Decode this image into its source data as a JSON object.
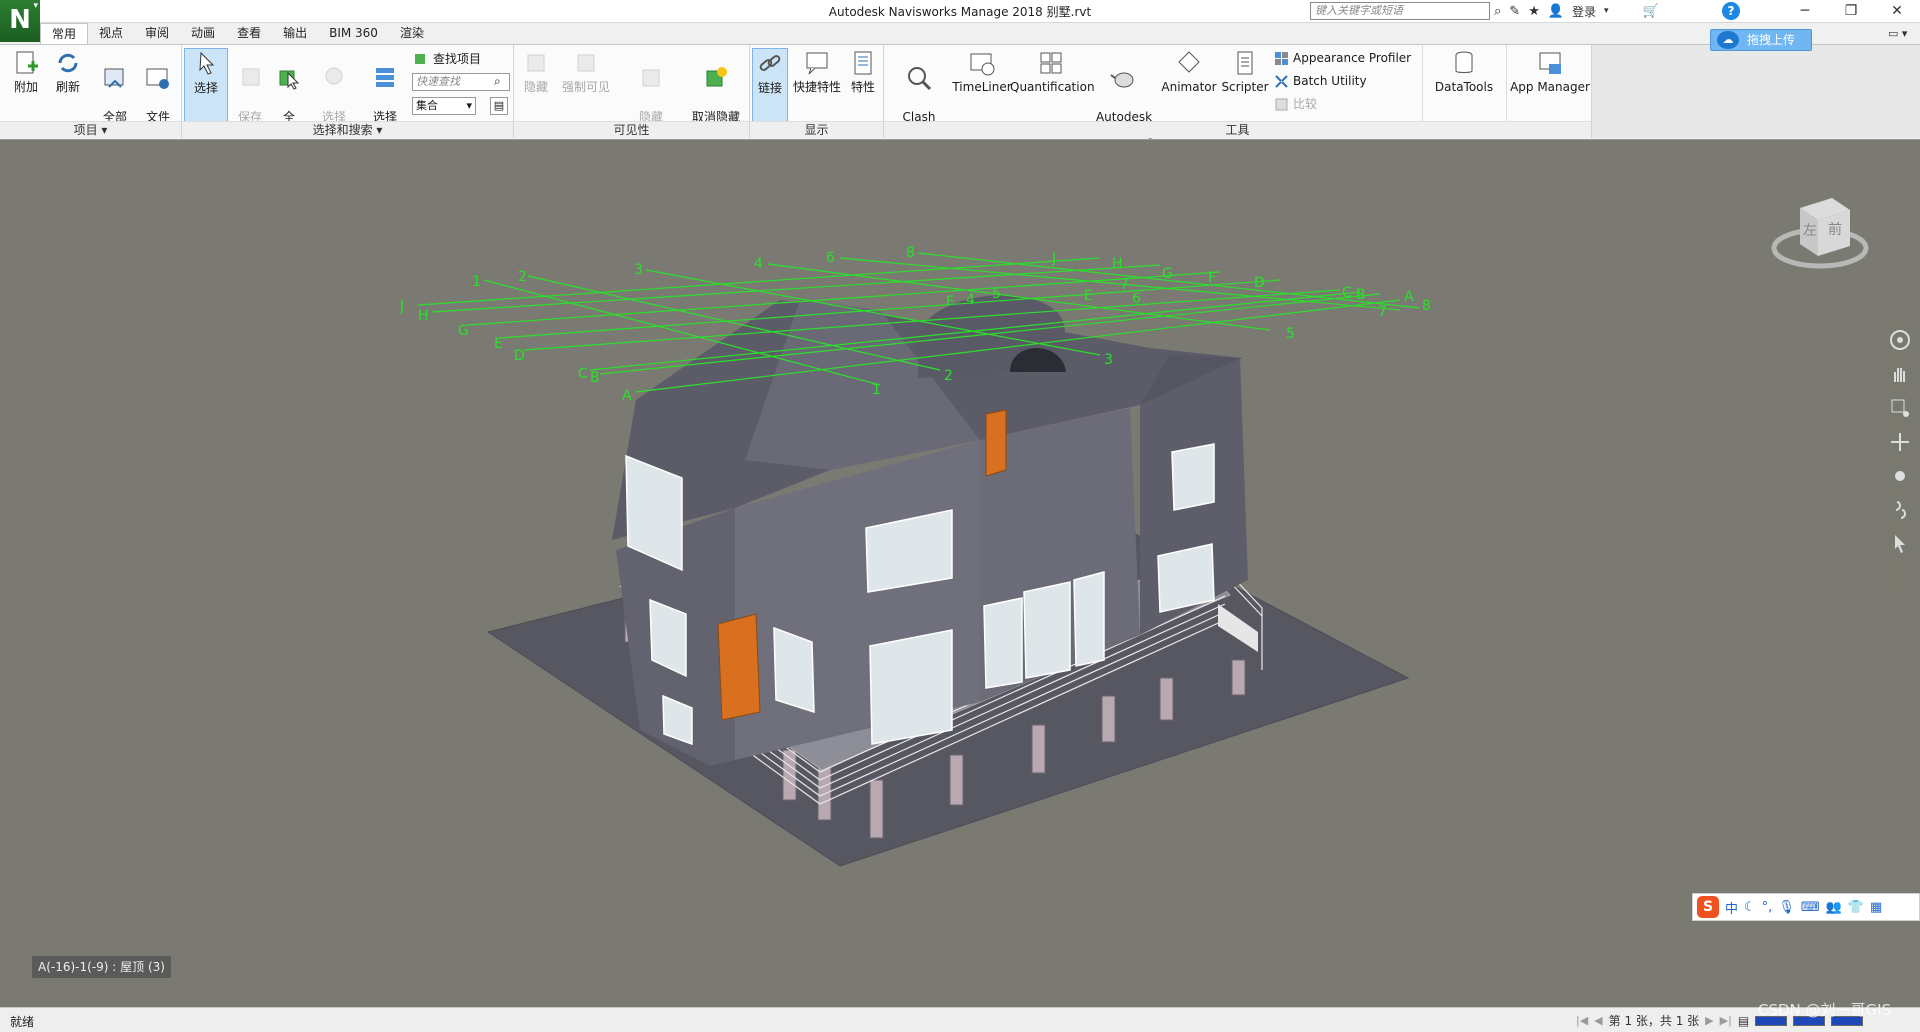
{
  "window": {
    "title": "Autodesk Navisworks Manage 2018    别墅.rvt",
    "app_logo": "N",
    "search_placeholder": "键入关键字或短语",
    "login": "登录",
    "help": "?",
    "upload_button": "拖拽上传"
  },
  "tabs": [
    "常用",
    "视点",
    "审阅",
    "动画",
    "查看",
    "输出",
    "BIM 360",
    "渲染"
  ],
  "active_tab": "常用",
  "ribbon": {
    "project_panel": {
      "label": "项目 ▾",
      "buttons": [
        {
          "label": "附加"
        },
        {
          "label": "刷新"
        },
        {
          "label": "全部\n重置..."
        },
        {
          "label": "文件\n选项"
        }
      ]
    },
    "select_panel": {
      "label": "选择和搜索 ▾",
      "select": "选择",
      "save_select": "保存\n选择",
      "select_all": "全\n选",
      "select_same": "选择\n相同对象",
      "select_tree": "选择\n树",
      "find_items": "查找项目",
      "quick_find_placeholder": "快速查找",
      "sets": "集合"
    },
    "visibility_panel": {
      "label": "可见性",
      "hide": "隐藏",
      "require": "强制可见",
      "hide_unselected": "隐藏\n未选定对象",
      "unhide_all": "取消隐藏\n所有对象"
    },
    "display_panel": {
      "label": "显示",
      "links": "链接",
      "quick_props": "快捷特性",
      "properties": "特性"
    },
    "tools_panel": {
      "label": "工具",
      "clash": "Clash\nDetective",
      "timeliner": "TimeLiner",
      "quantification": "Quantification",
      "rendering": "Autodesk\nRendering",
      "animator": "Animator",
      "scripter": "Scripter",
      "appearance_profiler": "Appearance Profiler",
      "batch_utility": "Batch Utility",
      "compare": "比较",
      "datatools": "DataTools",
      "app_manager": "App Manager"
    }
  },
  "viewport": {
    "status_overlay": "A(-16)-1(-9) : 屋顶 (3)",
    "viewcube": {
      "left": "左",
      "front": "前"
    },
    "grid_labels_numbers": [
      "1",
      "2",
      "3",
      "4",
      "5",
      "6",
      "7",
      "8",
      "1",
      "2",
      "3",
      "4",
      "5",
      "6",
      "7",
      "8"
    ],
    "grid_labels_letters": [
      "J",
      "H",
      "G",
      "E",
      "D",
      "C",
      "B",
      "A",
      "J",
      "H",
      "G",
      "F",
      "D",
      "C",
      "B",
      "A",
      "F",
      "E"
    ]
  },
  "ime": {
    "logo": "S",
    "mode": "中"
  },
  "statusbar": {
    "text": "就绪",
    "sheet_info": "第 1 张，共 1 张",
    "watermark": "CSDN @刘一哥GIS"
  },
  "colors": {
    "viewport_bg": "#7a7a72",
    "grid_green": "#2be02b",
    "building_wall": "#6e6e7c",
    "door_orange": "#d87020",
    "ground": "#55555f"
  }
}
